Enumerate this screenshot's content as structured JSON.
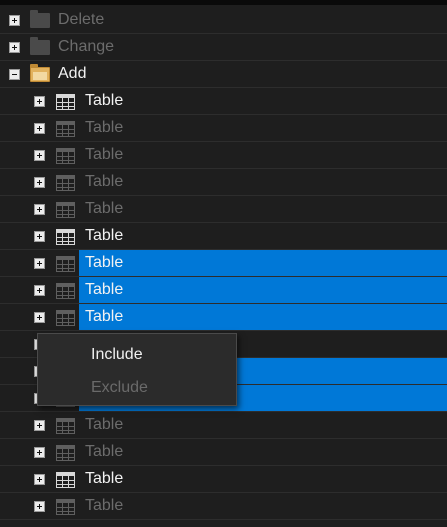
{
  "tree": {
    "folders": [
      {
        "label": "Delete",
        "state": "collapsed",
        "dim": true
      },
      {
        "label": "Change",
        "state": "collapsed",
        "dim": true
      },
      {
        "label": "Add",
        "state": "expanded",
        "dim": false
      }
    ],
    "children": [
      {
        "label": "Table",
        "dim": false,
        "selected": false
      },
      {
        "label": "Table",
        "dim": true,
        "selected": false
      },
      {
        "label": "Table",
        "dim": true,
        "selected": false
      },
      {
        "label": "Table",
        "dim": true,
        "selected": false
      },
      {
        "label": "Table",
        "dim": true,
        "selected": false
      },
      {
        "label": "Table",
        "dim": false,
        "selected": false
      },
      {
        "label": "Table",
        "dim": true,
        "selected": true
      },
      {
        "label": "Table",
        "dim": true,
        "selected": true
      },
      {
        "label": "Table",
        "dim": true,
        "selected": true
      },
      {
        "label": "",
        "dim": true,
        "selected": false
      },
      {
        "label": "",
        "dim": true,
        "selected": true
      },
      {
        "label": "",
        "dim": true,
        "selected": true
      },
      {
        "label": "Table",
        "dim": true,
        "selected": false
      },
      {
        "label": "Table",
        "dim": true,
        "selected": false
      },
      {
        "label": "Table",
        "dim": false,
        "selected": false
      },
      {
        "label": "Table",
        "dim": true,
        "selected": false
      }
    ]
  },
  "context_menu": {
    "items": [
      {
        "label": "Include",
        "enabled": true
      },
      {
        "label": "Exclude",
        "enabled": false
      }
    ]
  },
  "colors": {
    "selection": "#0078d7",
    "background": "#1e1e1e"
  },
  "icons": {
    "folder": "folder-icon",
    "folder_open": "folder-open-icon",
    "table": "table-grid-icon",
    "expand": "expand-plus-icon",
    "collapse": "collapse-minus-icon"
  }
}
